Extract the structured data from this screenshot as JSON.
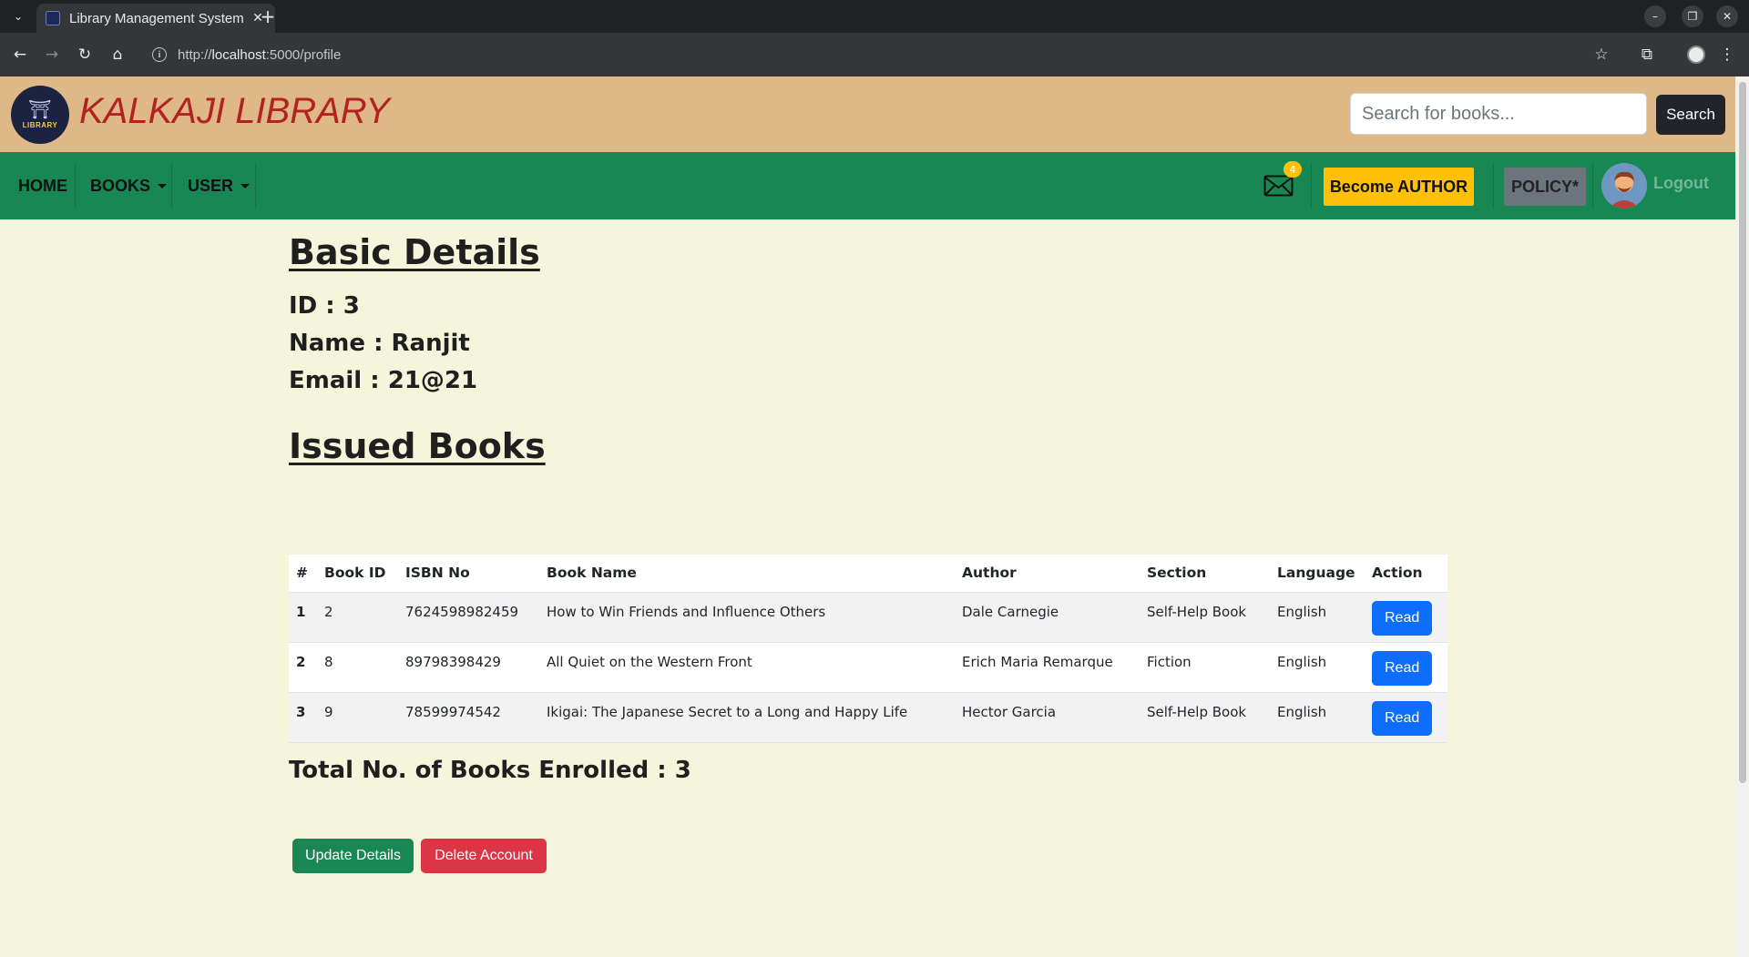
{
  "browser": {
    "tab_title": "Library Management System",
    "url_scheme": "http://",
    "url_host": "localhost",
    "url_path": ":5000/profile"
  },
  "header": {
    "logo_text": "LIBRARY",
    "site_title": "KALKAJI LIBRARY",
    "search_placeholder": "Search for books...",
    "search_button": "Search"
  },
  "nav": {
    "home": "HOME",
    "books": "BOOKS",
    "user": "USER",
    "mail_badge": "4",
    "become_author": "Become AUTHOR",
    "policy": "POLICY*",
    "logout": "Logout"
  },
  "profile": {
    "basic_heading": "Basic Details",
    "id_line": "ID : 3",
    "name_line": "Name : Ranjit",
    "email_line": "Email : 21@21",
    "issued_heading": "Issued Books",
    "total_line": "Total No. of Books Enrolled : 3",
    "update_button": "Update Details",
    "delete_button": "Delete Account"
  },
  "table": {
    "headers": [
      "#",
      "Book ID",
      "ISBN No",
      "Book Name",
      "Author",
      "Section",
      "Language",
      "Action"
    ],
    "rows": [
      {
        "num": "1",
        "book_id": "2",
        "isbn": "7624598982459",
        "name": "How to Win Friends and Influence Others",
        "author": "Dale Carnegie",
        "section": "Self-Help Book",
        "language": "English",
        "action": "Read"
      },
      {
        "num": "2",
        "book_id": "8",
        "isbn": "89798398429",
        "name": "All Quiet on the Western Front",
        "author": "Erich Maria Remarque",
        "section": "Fiction",
        "language": "English",
        "action": "Read"
      },
      {
        "num": "3",
        "book_id": "9",
        "isbn": "78599974542",
        "name": "Ikigai: The Japanese Secret to a Long and Happy Life",
        "author": "Hector Garcia",
        "section": "Self-Help Book",
        "language": "English",
        "action": "Read"
      }
    ]
  },
  "colors": {
    "header_bg": "#deb887",
    "nav_bg": "#198754",
    "page_bg": "#f5f5dc",
    "title_color": "#b22222",
    "author_btn": "#ffc107",
    "read_btn": "#0d6efd",
    "delete_btn": "#dc3545"
  },
  "icons": [
    "tab-list-icon",
    "close-icon",
    "plus-icon",
    "back-icon",
    "forward-icon",
    "reload-icon",
    "home-icon",
    "info-icon",
    "star-icon",
    "extensions-icon",
    "menu-icon",
    "mail-icon",
    "avatar-icon"
  ]
}
